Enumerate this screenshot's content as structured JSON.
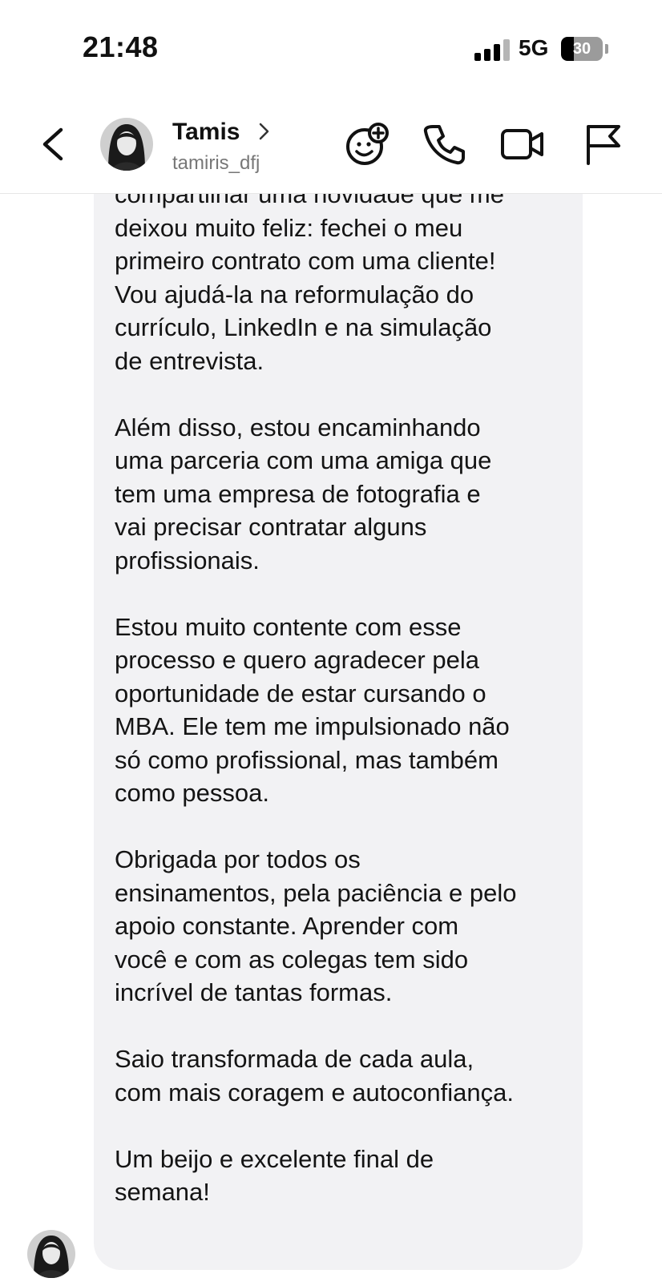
{
  "status_bar": {
    "time": "21:48",
    "network": "5G",
    "battery_percent": "30",
    "battery_level": 0.3,
    "signal_bars_active": 3,
    "signal_bars_total": 4
  },
  "header": {
    "contact_name": "Tamis",
    "username": "tamiris_dfj",
    "icons": [
      "back-icon",
      "chevron-right-icon",
      "sticker-add-icon",
      "phone-icon",
      "video-call-icon",
      "flag-icon"
    ]
  },
  "message": {
    "text": "compartilhar uma novidade que me\ndeixou muito feliz: fechei o meu\nprimeiro contrato com uma cliente!\nVou ajudá-la na reformulação do\ncurrículo, LinkedIn e na simulação\nde entrevista.\n\nAlém disso, estou encaminhando\numa parceria com uma amiga que\ntem uma empresa de fotografia e\nvai precisar contratar alguns\nprofissionais.\n\nEstou muito contente com esse\nprocesso e quero agradecer pela\noportunidade de estar cursando o\nMBA. Ele tem me impulsionado não\nsó como profissional, mas também\ncomo pessoa.\n\nObrigada por todos os\nensinamentos, pela paciência e pelo\napoio constante. Aprender com\nvocê e com as colegas tem sido\nincrível de tantas formas.\n\nSaio transformada de cada aula,\ncom mais coragem e autoconfiança.\n\nUm beijo e excelente final de\nsemana!"
  },
  "colors": {
    "bubble_bg": "#f2f2f4",
    "text": "#141414",
    "secondary_text": "#777777",
    "divider": "#e6e6e6"
  }
}
